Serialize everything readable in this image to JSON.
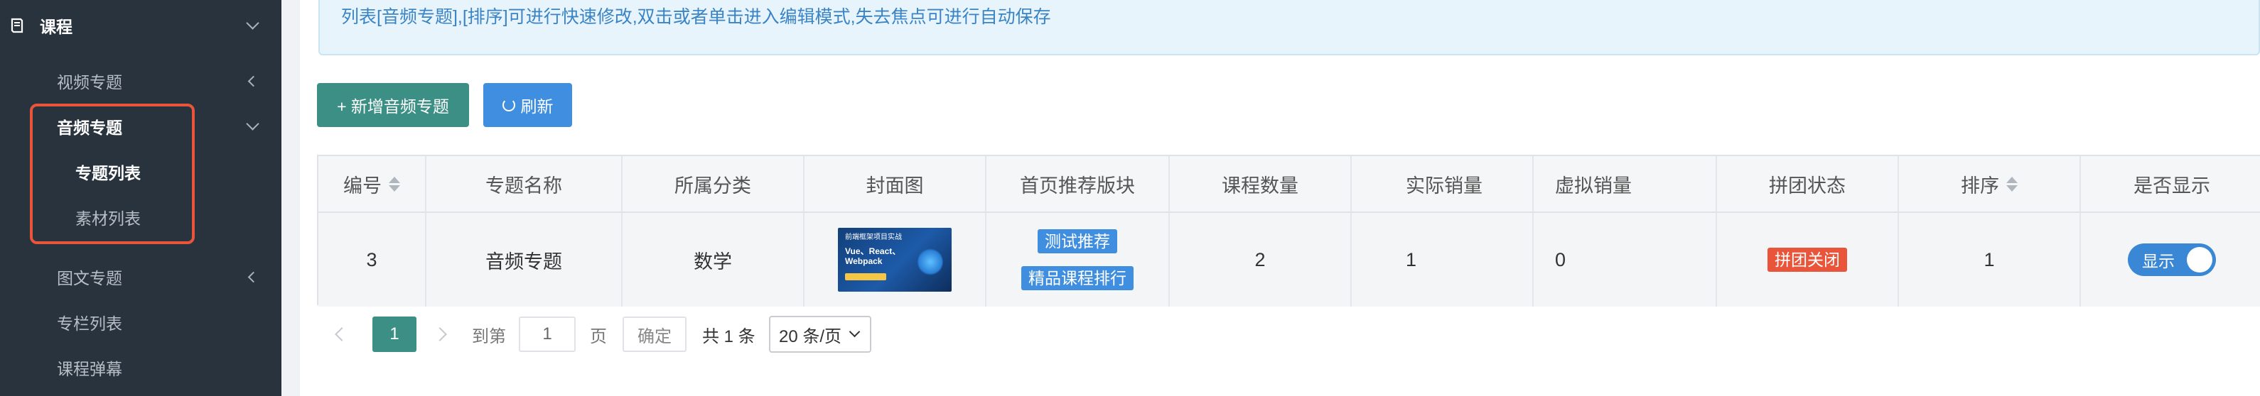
{
  "sidebar": {
    "section_title": "课程",
    "items": [
      {
        "label": "视频专题"
      },
      {
        "label": "音频专题"
      },
      {
        "label": "专题列表"
      },
      {
        "label": "素材列表"
      },
      {
        "label": "图文专题"
      },
      {
        "label": "专栏列表"
      },
      {
        "label": "课程弹幕"
      }
    ]
  },
  "notice": {
    "text": "列表[音频专题],[排序]可进行快速修改,双击或者单击进入编辑模式,失去焦点可进行自动保存"
  },
  "toolbar": {
    "add_label": "+ 新增音频专题",
    "refresh_label": "刷新"
  },
  "table": {
    "headers": [
      "编号",
      "专题名称",
      "所属分类",
      "封面图",
      "首页推荐版块",
      "课程数量",
      "实际销量",
      "虚拟销量",
      "拼团状态",
      "排序",
      "是否显示"
    ],
    "rows": [
      {
        "id": "3",
        "name": "音频专题",
        "category": "数学",
        "cover_line1": "前端框架项目实战",
        "cover_line2": "Vue、React、Webpack",
        "recommend": [
          "测试推荐",
          "精品课程排行"
        ],
        "course_count": "2",
        "actual_sales": "1",
        "virtual_sales": "0",
        "group_status": "拼团关闭",
        "sort": "1",
        "display": "显示"
      }
    ]
  },
  "pagination": {
    "current_page": "1",
    "goto_label": "到第",
    "page_input": "1",
    "page_suffix": "页",
    "confirm_label": "确定",
    "total_label": "共 1 条",
    "page_size": "20 条/页"
  },
  "colors": {
    "sidebar_bg": "#28333e",
    "primary_green": "#3c8f84",
    "primary_blue": "#3f8ee0",
    "danger": "#e8553a"
  }
}
